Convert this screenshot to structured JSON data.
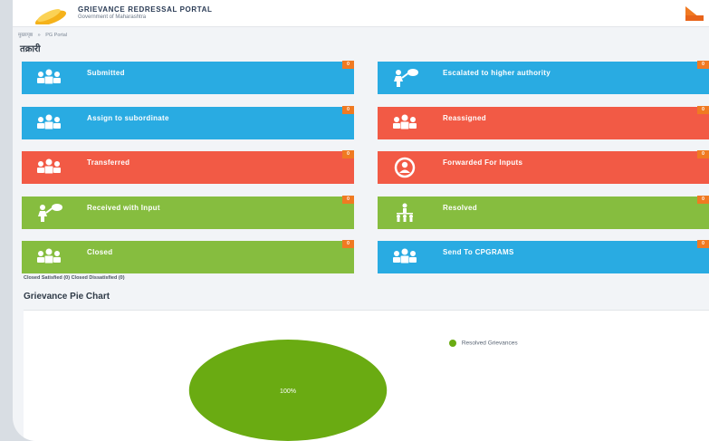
{
  "header": {
    "title": "GRIEVANCE REDRESSAL PORTAL",
    "subtitle": "Government of Maharashtra"
  },
  "breadcrumb": {
    "home": "मुख्यपृष्ठ",
    "separator": "»",
    "current": "PG Portal"
  },
  "page": {
    "heading": "तक्रारी"
  },
  "tiles": [
    {
      "label": "Submitted",
      "badge": "0",
      "color": "#29abe2",
      "icon": "people-group-icon"
    },
    {
      "label": "Escalated to higher authority",
      "badge": "0",
      "color": "#29abe2",
      "icon": "escalate-icon"
    },
    {
      "label": "Assign to subordinate",
      "badge": "0",
      "color": "#29abe2",
      "icon": "people-group-icon"
    },
    {
      "label": "Reassigned",
      "badge": "0",
      "color": "#f25a45",
      "icon": "people-group-icon"
    },
    {
      "label": "Transferred",
      "badge": "0",
      "color": "#f25a45",
      "icon": "people-group-icon"
    },
    {
      "label": "Forwarded For Inputs",
      "badge": "0",
      "color": "#f25a45",
      "icon": "user-circle-icon"
    },
    {
      "label": "Received with Input",
      "badge": "0",
      "color": "#86bd3f",
      "icon": "escalate-icon"
    },
    {
      "label": "Resolved",
      "badge": "0",
      "color": "#86bd3f",
      "icon": "hierarchy-icon"
    },
    {
      "label": "Closed",
      "badge": "0",
      "color": "#86bd3f",
      "icon": "people-group-icon"
    },
    {
      "label": "Send To CPGRAMS",
      "badge": "0",
      "color": "#29abe2",
      "icon": "people-group-icon"
    }
  ],
  "closed_note": "Closed Satisfied (0) Closed Dissatisfied (0)",
  "chart_heading": "Grievance Pie Chart",
  "chart_data": {
    "type": "pie",
    "categories": [
      "Resolved Grievances"
    ],
    "values": [
      100
    ],
    "slice_label": "100%",
    "colors": [
      "#6aab12"
    ],
    "legend_position": "right"
  }
}
